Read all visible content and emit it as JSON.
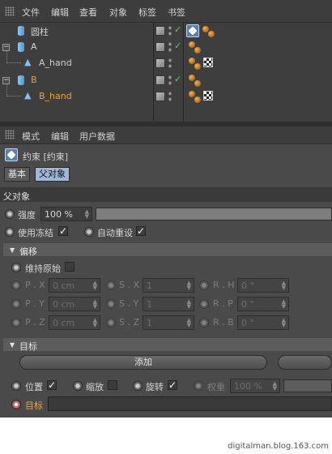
{
  "menubar": {
    "items": [
      "文件",
      "编辑",
      "查看",
      "对象",
      "标签",
      "书签"
    ]
  },
  "objects": [
    {
      "name": "圆柱",
      "type": "cylinder",
      "selected": false,
      "tag": "constraint"
    },
    {
      "name": "A",
      "type": "cylinder",
      "selected": false,
      "tag": "material"
    },
    {
      "name": "A_hand",
      "type": "joint",
      "selected": false,
      "tag": "checker"
    },
    {
      "name": "B",
      "type": "cylinder",
      "selected": true,
      "tag": "material"
    },
    {
      "name": "B_hand",
      "type": "joint",
      "selected": true,
      "tag": "checker"
    }
  ],
  "attr_menu": {
    "items": [
      "模式",
      "编辑",
      "用户数据"
    ]
  },
  "attr": {
    "title": "约束 [约束]",
    "tabs": [
      "基本",
      "父对象"
    ],
    "active_tab": "父对象",
    "section_parent": "父对象",
    "strength_label": "强度",
    "strength_value": "100 %",
    "freeze_label": "使用冻结",
    "autoreset_label": "自动重设",
    "offset_section": "偏移",
    "keep_origin_label": "维持原始",
    "pos_labels": [
      "P . X",
      "P . Y",
      "P . Z"
    ],
    "pos_values": [
      "0 cm",
      "0 cm",
      "0 cm"
    ],
    "scale_labels": [
      "S . X",
      "S . Y",
      "S . Z"
    ],
    "scale_values": [
      "1",
      "1",
      "1"
    ],
    "rot_labels": [
      "R . H",
      "R . P",
      "R . B"
    ],
    "rot_values": [
      "0 °",
      "0 °",
      "0 °"
    ],
    "target_section": "目标",
    "add_button": "添加",
    "position_label": "位置",
    "scale_label": "缩放",
    "rotate_label": "旋转",
    "weight_label": "权重",
    "weight_value": "100 %",
    "target_label": "目标"
  },
  "watermark": "digitalman.blog.163.com",
  "colors": {
    "selected": "#e7a53c",
    "active_tab": "#9fb7d9",
    "check": "#58d158"
  }
}
